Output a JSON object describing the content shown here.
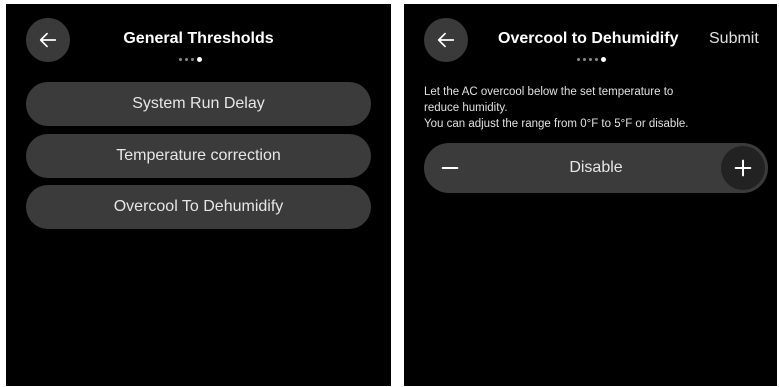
{
  "left_screen": {
    "title": "General Thresholds",
    "back_icon": "arrow-left-icon",
    "page_indicator": {
      "count": 4,
      "active_index": 3
    },
    "menu_items": [
      {
        "label": "System Run Delay"
      },
      {
        "label": "Temperature correction"
      },
      {
        "label": "Overcool To Dehumidify"
      }
    ]
  },
  "right_screen": {
    "title": "Overcool to Dehumidify",
    "submit_label": "Submit",
    "back_icon": "arrow-left-icon",
    "page_indicator": {
      "count": 5,
      "active_index": 4
    },
    "description_lines": [
      "Let the AC overcool below the set temperature to",
      "reduce humidity.",
      "You can adjust the range from 0°F to 5°F or disable."
    ],
    "stepper": {
      "value": "Disable",
      "minus_icon": "minus-icon",
      "plus_icon": "plus-icon"
    }
  },
  "colors": {
    "screen_bg": "#000000",
    "pill_bg": "#3b3b3b",
    "back_btn_bg": "#3a3a3a",
    "text": "#e6e6e6",
    "dot_inactive": "#8a8a8a",
    "dot_active": "#ffffff"
  }
}
